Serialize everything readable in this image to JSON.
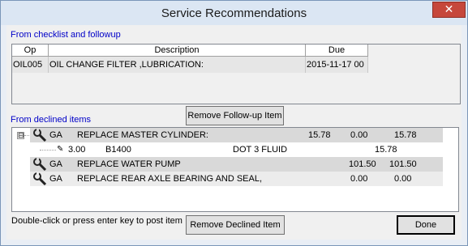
{
  "window": {
    "title": "Service Recommendations"
  },
  "checklist": {
    "section_label": "From checklist and followup",
    "columns": [
      "Op",
      "Description",
      "Due"
    ],
    "rows": [
      {
        "op": "OIL005",
        "description": "OIL CHANGE FILTER ,LUBRICATION:",
        "due": "2015-11-17 00"
      }
    ]
  },
  "buttons": {
    "remove_followup": "Remove Follow-up Item",
    "remove_declined": "Remove Declined Item",
    "done": "Done"
  },
  "declined": {
    "section_label": "From declined items",
    "items": [
      {
        "expander": "⊟",
        "type": "GA",
        "description": "REPLACE MASTER CYLINDER:",
        "v1": "15.78",
        "v2": "0.00",
        "v3": "15.78"
      },
      {
        "qty": "3.00",
        "part": "B1400",
        "description": "DOT 3 FLUID",
        "amount": "15.78"
      },
      {
        "type": "GA",
        "description": "REPLACE WATER PUMP",
        "v1": "101.50",
        "v2": "101.50"
      },
      {
        "type": "GA",
        "description": "REPLACE REAR AXLE BEARING AND SEAL,",
        "v1": "0.00",
        "v2": "0.00"
      }
    ]
  },
  "footer": {
    "hint": "Double-click or press enter key to post item"
  }
}
